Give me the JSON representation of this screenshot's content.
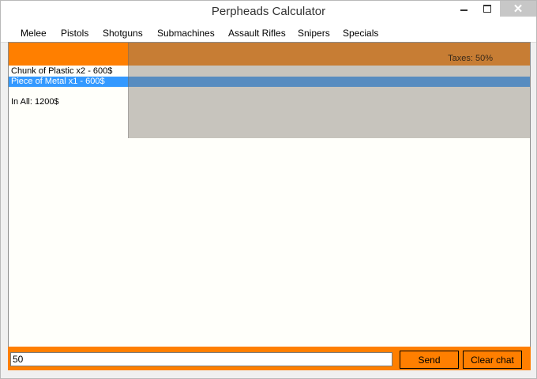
{
  "window": {
    "title": "Perpheads Calculator",
    "close_glyph": "✕"
  },
  "menu": [
    {
      "label": "Melee"
    },
    {
      "label": "Pistols"
    },
    {
      "label": "Shotguns"
    },
    {
      "label": "Submachines"
    },
    {
      "label": "Assault Rifles"
    },
    {
      "label": "Snipers"
    },
    {
      "label": "Specials"
    }
  ],
  "header": {
    "taxes_label": "Taxes: 50%"
  },
  "list": {
    "items": [
      {
        "text": "Chunk of Plastic x2 - 600$",
        "selected": false
      },
      {
        "text": "Piece of Metal x1 - 600$",
        "selected": true
      }
    ],
    "total": "In All: 1200$"
  },
  "footer": {
    "input_value": "50",
    "send_label": "Send",
    "clear_label": "Clear chat"
  },
  "colors": {
    "accent": "#ff7f00",
    "selection": "#3399ff"
  }
}
